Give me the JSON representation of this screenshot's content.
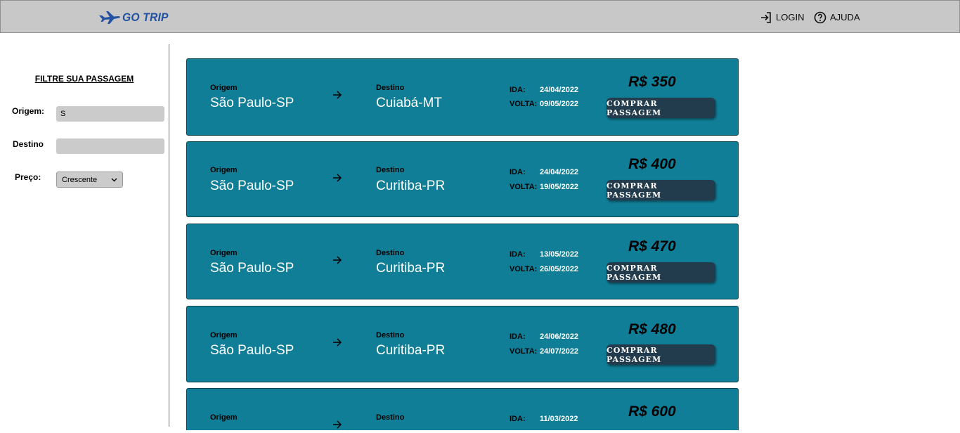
{
  "header": {
    "logo_text": "GO TRIP",
    "login_label": "LOGIN",
    "help_label": "AJUDA"
  },
  "filter": {
    "title": "FILTRE SUA PASSAGEM",
    "origin_label": "Origem:",
    "origin_value": "S",
    "destination_label": "Destino",
    "destination_value": "",
    "price_label": "Preço:",
    "price_order_selected": "Crescente"
  },
  "tickets": [
    {
      "origin_label": "Origem",
      "origin": "São Paulo-SP",
      "dest_label": "Destino",
      "destination": "Cuiabá-MT",
      "ida_label": "IDA:",
      "ida": "24/04/2022",
      "volta_label": "VOLTA:",
      "volta": "09/05/2022",
      "price": "R$ 350",
      "button": "COMPRAR PASSAGEM"
    },
    {
      "origin_label": "Origem",
      "origin": "São Paulo-SP",
      "dest_label": "Destino",
      "destination": "Curitiba-PR",
      "ida_label": "IDA:",
      "ida": "24/04/2022",
      "volta_label": "VOLTA:",
      "volta": "19/05/2022",
      "price": "R$ 400",
      "button": "COMPRAR PASSAGEM"
    },
    {
      "origin_label": "Origem",
      "origin": "São Paulo-SP",
      "dest_label": "Destino",
      "destination": "Curitiba-PR",
      "ida_label": "IDA:",
      "ida": "13/05/2022",
      "volta_label": "VOLTA:",
      "volta": "26/05/2022",
      "price": "R$ 470",
      "button": "COMPRAR PASSAGEM"
    },
    {
      "origin_label": "Origem",
      "origin": "São Paulo-SP",
      "dest_label": "Destino",
      "destination": "Curitiba-PR",
      "ida_label": "IDA:",
      "ida": "24/06/2022",
      "volta_label": "VOLTA:",
      "volta": "24/07/2022",
      "price": "R$ 480",
      "button": "COMPRAR PASSAGEM"
    },
    {
      "origin_label": "Origem",
      "origin": "",
      "dest_label": "Destino",
      "destination": "",
      "ida_label": "IDA:",
      "ida": "11/03/2022",
      "volta_label": "",
      "volta": "",
      "price": "R$ 600",
      "button": ""
    }
  ],
  "colors": {
    "header_bg": "#c8c8c8",
    "card_bg": "#107e97",
    "button_bg": "#233c4d",
    "logo": "#2251a3"
  },
  "icons": {
    "logo": "airplane-icon",
    "login": "login-arrow-icon",
    "help": "question-circle-icon",
    "route": "arrow-right-icon",
    "select": "chevron-down-icon"
  }
}
